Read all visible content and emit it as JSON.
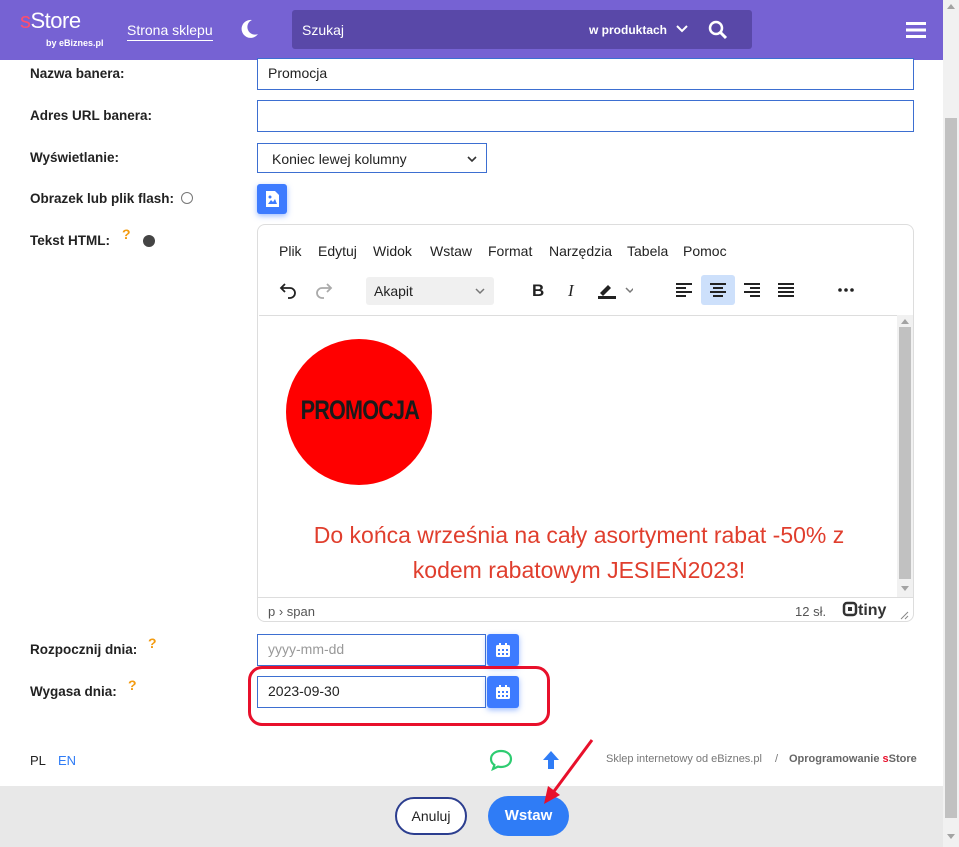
{
  "header": {
    "logo_s": "s",
    "logo_store": "Store",
    "logo_by": "by eBiznes.pl",
    "store_link": "Strona sklepu",
    "search_placeholder": "Szukaj",
    "search_scope": "w produktach"
  },
  "form": {
    "banner_name_label": "Nazwa banera:",
    "banner_name_value": "Promocja",
    "banner_url_label": "Adres URL banera:",
    "banner_url_value": "",
    "display_label": "Wyświetlanie:",
    "display_value": "Koniec lewej kolumny",
    "image_label": "Obrazek lub plik flash:",
    "html_label": "Tekst HTML:",
    "start_label": "Rozpocznij dnia:",
    "start_placeholder": "yyyy-mm-dd",
    "start_value": "",
    "expire_label": "Wygasa dnia:",
    "expire_value": "2023-09-30",
    "help_mark": "?"
  },
  "editor": {
    "menu": [
      "Plik",
      "Edytuj",
      "Widok",
      "Wstaw",
      "Format",
      "Narzędzia",
      "Tabela",
      "Pomoc"
    ],
    "block_format": "Akapit",
    "promo_badge": "PROMOCJA",
    "promo_text": "Do końca września na cały asortyment rabat -50% z kodem rabatowym JESIEŃ2023!",
    "status_path": "p › span",
    "word_count": "12 sł.",
    "brand": "tiny",
    "promo_color": "#e03e2d",
    "badge_color": "#ff0000"
  },
  "footer": {
    "lang_pl": "PL",
    "lang_en": "EN",
    "shop_link": "Sklep internetowy od eBiznes.pl",
    "separator": "/",
    "software_prefix": "Oprogramowanie ",
    "software_s": "s",
    "software_store": "Store"
  },
  "actions": {
    "cancel": "Anuluj",
    "insert": "Wstaw"
  },
  "colors": {
    "header_bg": "#7662d3",
    "accent_blue": "#2f7cf6",
    "highlight_red": "#e8102b"
  }
}
